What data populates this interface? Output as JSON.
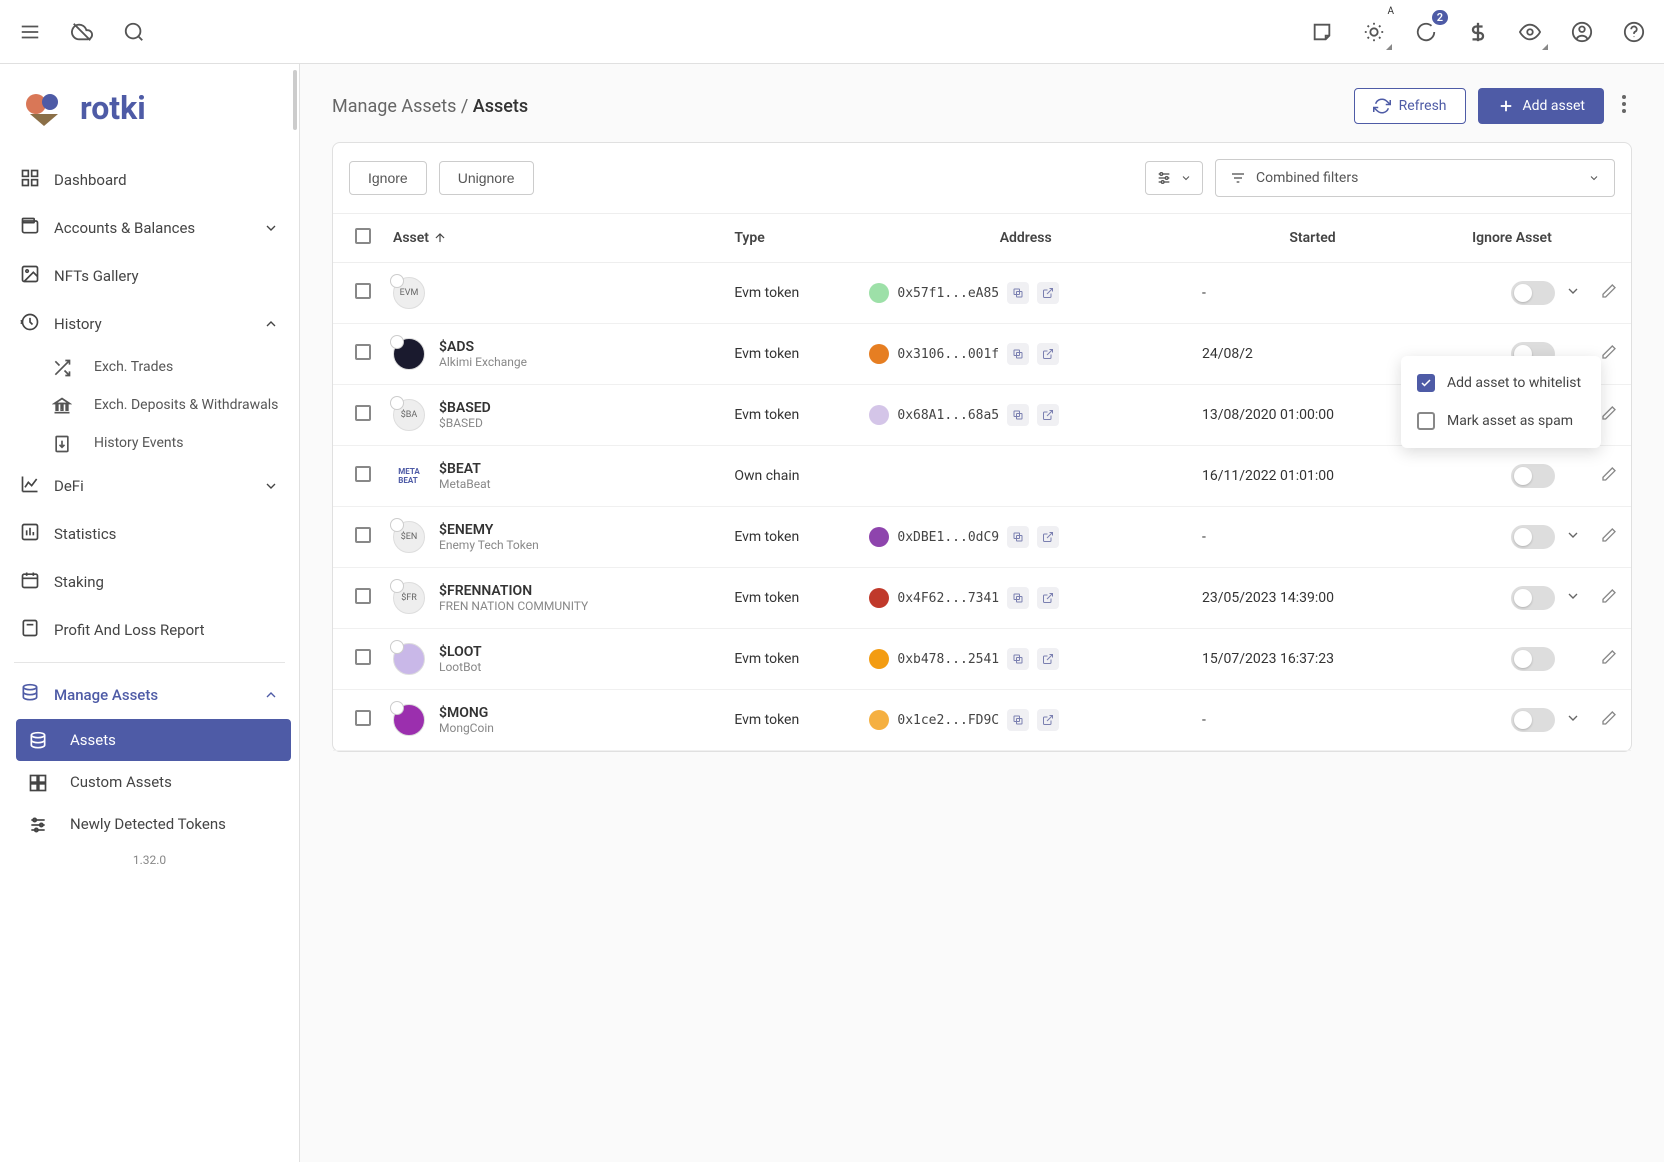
{
  "app": {
    "name": "rotki",
    "version": "1.32.0"
  },
  "topbar": {
    "notif_count": "2",
    "auto_label": "A"
  },
  "breadcrumb": {
    "parent": "Manage Assets",
    "current": "Assets"
  },
  "page_actions": {
    "refresh": "Refresh",
    "add": "Add asset"
  },
  "toolbar": {
    "ignore": "Ignore",
    "unignore": "Unignore",
    "filters_label": "Combined filters"
  },
  "columns": {
    "asset": "Asset",
    "type": "Type",
    "address": "Address",
    "started": "Started",
    "ignore": "Ignore Asset"
  },
  "sidebar": {
    "items": [
      {
        "label": "Dashboard",
        "icon": "dashboard"
      },
      {
        "label": "Accounts & Balances",
        "icon": "wallet",
        "chev": "down"
      },
      {
        "label": "NFTs Gallery",
        "icon": "image"
      },
      {
        "label": "History",
        "icon": "history",
        "chev": "up",
        "children": [
          {
            "label": "Exch. Trades",
            "icon": "shuffle"
          },
          {
            "label": "Exch. Deposits & Withdrawals",
            "icon": "bank"
          },
          {
            "label": "History Events",
            "icon": "doc-arrow"
          }
        ]
      },
      {
        "label": "DeFi",
        "icon": "chart",
        "chev": "down"
      },
      {
        "label": "Statistics",
        "icon": "bar"
      },
      {
        "label": "Staking",
        "icon": "calendar"
      },
      {
        "label": "Profit And Loss Report",
        "icon": "calc"
      }
    ],
    "manage": {
      "label": "Manage Assets",
      "children": [
        {
          "label": "Assets",
          "active": true,
          "icon": "db"
        },
        {
          "label": "Custom Assets",
          "icon": "grid"
        },
        {
          "label": "Newly Detected Tokens",
          "icon": "sliders"
        }
      ]
    }
  },
  "popup": {
    "whitelist": "Add asset to whitelist",
    "spam": "Mark asset as spam"
  },
  "rows": [
    {
      "symbol": "",
      "name": "",
      "icon_txt": "EVM",
      "type": "Evm token",
      "chain_color": "#9de0a8",
      "address": "0x57f1...eA85",
      "started": "-",
      "show_chev": true
    },
    {
      "symbol": "$ADS",
      "name": "Alkimi Exchange",
      "icon_bg": "#1a1a2e",
      "type": "Evm token",
      "chain_color": "#e67e22",
      "address": "0x3106...001f",
      "started": "24/08/2",
      "show_chev": false,
      "popup": true
    },
    {
      "symbol": "$BASED",
      "name": "$BASED",
      "icon_txt": "$BA",
      "type": "Evm token",
      "chain_color": "#d4c5e8",
      "address": "0x68A1...68a5",
      "started": "13/08/2020 01:00:00",
      "show_chev": true
    },
    {
      "symbol": "$BEAT",
      "name": "MetaBeat",
      "icon_plain": true,
      "type": "Own chain",
      "chain_color": "",
      "address": "",
      "started": "16/11/2022 01:01:00",
      "show_chev": false
    },
    {
      "symbol": "$ENEMY",
      "name": "Enemy Tech Token",
      "icon_txt": "$EN",
      "type": "Evm token",
      "chain_color": "#8e44ad",
      "address": "0xDBE1...0dC9",
      "started": "-",
      "show_chev": true
    },
    {
      "symbol": "$FRENNATION",
      "name": "FREN NATION COMMUNITY",
      "icon_txt": "$FR",
      "type": "Evm token",
      "chain_color": "#c0392b",
      "address": "0x4F62...7341",
      "started": "23/05/2023 14:39:00",
      "show_chev": true
    },
    {
      "symbol": "$LOOT",
      "name": "LootBot",
      "icon_bg": "#c9b8e8",
      "type": "Evm token",
      "chain_color": "#f39c12",
      "address": "0xb478...2541",
      "started": "15/07/2023 16:37:23",
      "show_chev": false
    },
    {
      "symbol": "$MONG",
      "name": "MongCoin",
      "icon_bg": "#9b2fae",
      "type": "Evm token",
      "chain_color": "#f5b041",
      "address": "0x1ce2...FD9C",
      "started": "-",
      "show_chev": true
    }
  ]
}
